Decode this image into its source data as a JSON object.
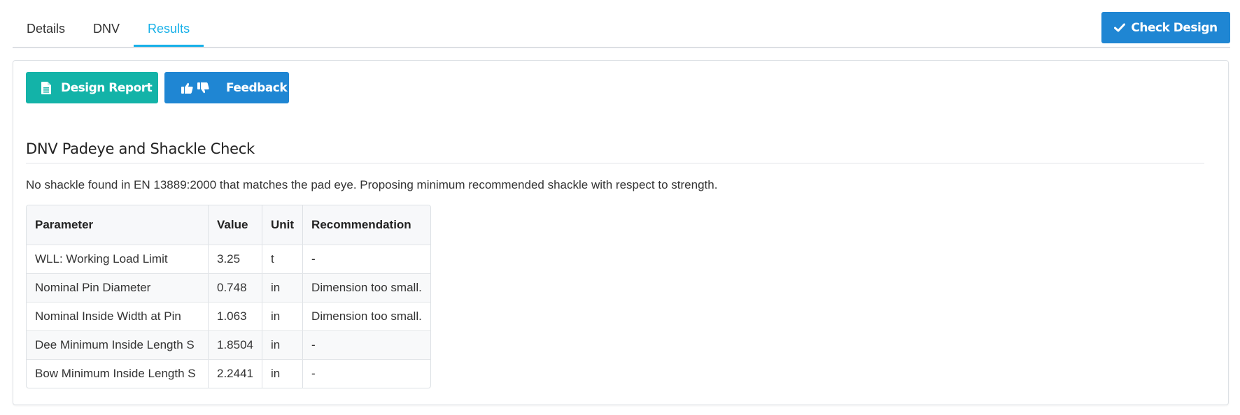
{
  "tabs": [
    {
      "label": "Details",
      "active": false
    },
    {
      "label": "DNV",
      "active": false
    },
    {
      "label": "Results",
      "active": true
    }
  ],
  "toolbar": {
    "check_design_label": "Check Design",
    "check_icon": "check-icon"
  },
  "actions": {
    "design_report_label": "Design Report",
    "design_report_icon": "document-icon",
    "feedback_label": "Feedback",
    "feedback_icons": [
      "thumbs-up-icon",
      "thumbs-down-icon"
    ]
  },
  "section": {
    "title": "DNV Padeye and Shackle Check",
    "message": "No shackle found in EN 13889:2000 that matches the pad eye. Proposing minimum recommended shackle with respect to strength."
  },
  "table": {
    "headers": [
      "Parameter",
      "Value",
      "Unit",
      "Recommendation"
    ],
    "rows": [
      [
        "WLL: Working Load Limit",
        "3.25",
        "t",
        "-"
      ],
      [
        "Nominal Pin Diameter",
        "0.748",
        "in",
        "Dimension too small."
      ],
      [
        "Nominal Inside Width at Pin",
        "1.063",
        "in",
        "Dimension too small."
      ],
      [
        "Dee Minimum Inside Length S",
        "1.8504",
        "in",
        "-"
      ],
      [
        "Bow Minimum Inside Length S",
        "2.2441",
        "in",
        "-"
      ]
    ]
  },
  "colors": {
    "accent": "#17b0e8",
    "primary_button": "#1f86d3",
    "report_button": "#13b3a8"
  }
}
